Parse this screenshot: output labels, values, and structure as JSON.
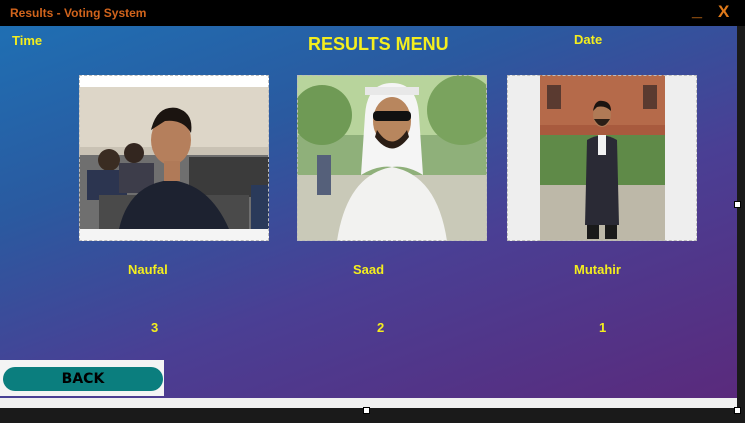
{
  "window": {
    "title": "Results - Voting System",
    "minimize_label": "_",
    "close_label": "X"
  },
  "header": {
    "time_label": "Time",
    "date_label": "Date",
    "heading": "RESULTS MENU"
  },
  "candidates": [
    {
      "name": "Naufal",
      "votes": "3"
    },
    {
      "name": "Saad",
      "votes": "2"
    },
    {
      "name": "Mutahir",
      "votes": "1"
    }
  ],
  "back_button": {
    "label": "BACK"
  },
  "colors": {
    "accent_text": "#f4ee1e",
    "title_text": "#d2641c",
    "back_button": "#0b7e7e"
  }
}
